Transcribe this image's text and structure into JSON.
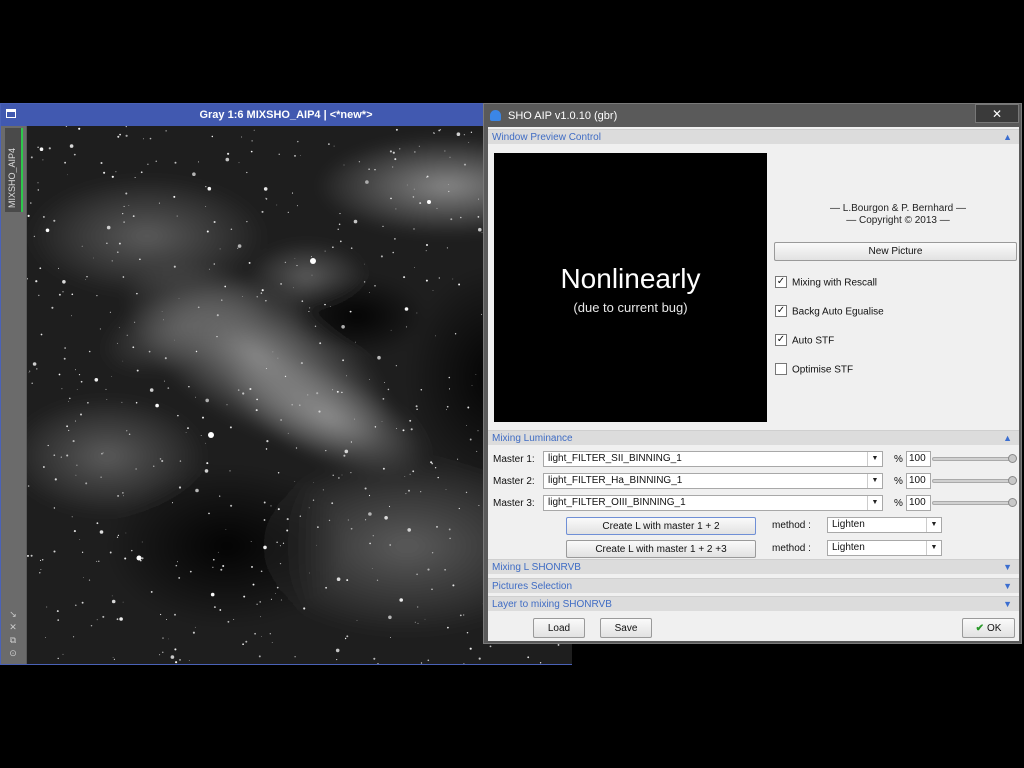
{
  "image_window": {
    "title": "Gray 1:6 MIXSHO_AIP4 | <*new*>",
    "tab_label": "MIXSHO_AIP4",
    "sidebar_icons": [
      "arrow-icon",
      "close-icon",
      "copy-icon",
      "settings-icon"
    ]
  },
  "dialog": {
    "title": "SHO AIP v1.0.10 (gbr)",
    "close_glyph": "✕",
    "sections": {
      "window_preview": "Window Preview Control",
      "mixing_luminance": "Mixing Luminance",
      "mixing_l_shonrvb": "Mixing L SHONRVB",
      "pictures_selection": "Pictures Selection",
      "layer_mixing": "Layer to mixing SHONRVB"
    },
    "preview": {
      "main_text": "Nonlinearly",
      "sub_text": "(due to current bug)"
    },
    "credits": {
      "line1": "— L.Bourgon & P. Bernhard —",
      "line2": "— Copyright © 2013 —"
    },
    "new_picture_button": "New Picture",
    "checkboxes": [
      {
        "label": "Mixing with Rescall",
        "checked": true
      },
      {
        "label": "Backg Auto Egualise",
        "checked": true
      },
      {
        "label": "Auto STF",
        "checked": true
      },
      {
        "label": "Optimise STF",
        "checked": false
      }
    ],
    "masters": [
      {
        "label": "Master 1:",
        "value": "light_FILTER_SII_BINNING_1",
        "pct_symbol": "%",
        "percent": "100",
        "slider_level": 1.0
      },
      {
        "label": "Master 2:",
        "value": "light_FILTER_Ha_BINNING_1",
        "pct_symbol": "%",
        "percent": "100",
        "slider_level": 1.0
      },
      {
        "label": "Master 3:",
        "value": "light_FILTER_OIII_BINNING_1",
        "pct_symbol": "%",
        "percent": "100",
        "slider_level": 1.0
      }
    ],
    "create_rows": [
      {
        "button": "Create L with master 1 + 2",
        "method_label": "method :",
        "method": "Lighten"
      },
      {
        "button": "Create L with master 1 + 2 +3",
        "method_label": "method :",
        "method": "Lighten"
      }
    ],
    "footer": {
      "load": "Load",
      "save": "Save",
      "ok": "OK"
    }
  },
  "colors": {
    "titlebar_blue": "#4159b0",
    "section_link_blue": "#3f6cc4",
    "tab_accent_green": "#2dc84b"
  }
}
